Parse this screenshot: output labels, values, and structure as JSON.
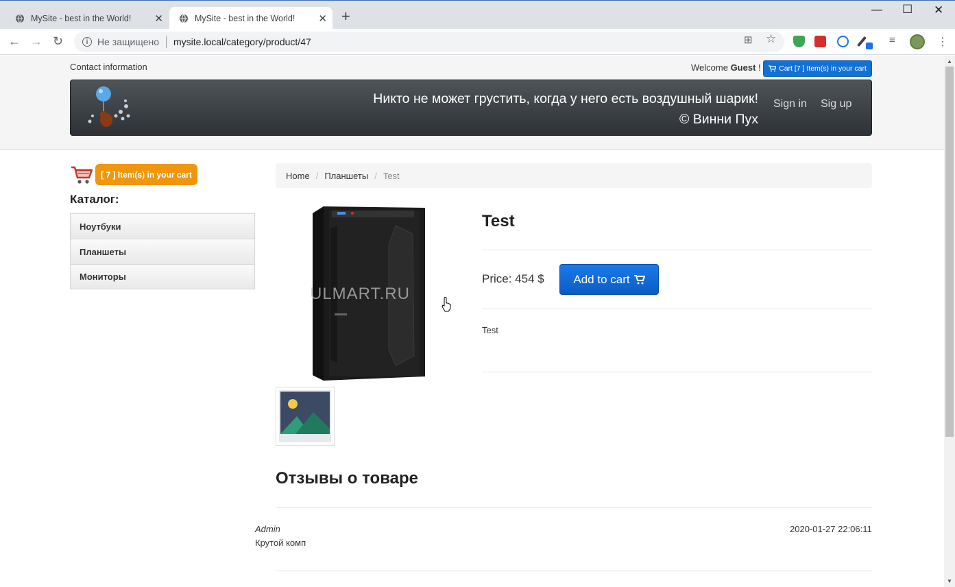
{
  "browser": {
    "tabs": [
      {
        "title": "MySite - best in the World!",
        "active": false
      },
      {
        "title": "MySite - best in the World!",
        "active": true
      }
    ],
    "security_label": "Не защищено",
    "url": "mysite.local/category/product/47"
  },
  "topbar": {
    "contact_link": "Contact information",
    "welcome_prefix": "Welcome ",
    "welcome_user": "Guest",
    "welcome_suffix": " !",
    "cart_button": "Cart [7 ] Item(s) in your cart"
  },
  "banner": {
    "quote_line1": "Никто не может грустить, когда у него есть воздушный шарик!",
    "quote_line2": "© Винни Пух",
    "signin": "Sign in",
    "signup": "Sig up"
  },
  "sidebar": {
    "cart_badge": "[ 7 ] Item(s) in your cart",
    "catalog_title": "Каталог:",
    "categories": [
      {
        "label": "Ноутбуки"
      },
      {
        "label": "Планшеты"
      },
      {
        "label": "Мониторы"
      }
    ]
  },
  "breadcrumb": {
    "home": "Home",
    "category": "Планшеты",
    "current": "Test",
    "separator": "/"
  },
  "product": {
    "title": "Test",
    "price": "Price: 454 $",
    "add_to_cart": "Add to cart",
    "description": "Test",
    "watermark": "ULMART.RU"
  },
  "reviews": {
    "title": "Отзывы о товаре",
    "items": [
      {
        "author": "Admin",
        "text": "Крутой комп",
        "date": "2020-01-27 22:06:11"
      }
    ]
  },
  "colors": {
    "cart_button": "#1271d6",
    "cart_badge": "#f0960c",
    "add_to_cart": "#0b5cc4",
    "banner": "#3a3e42"
  }
}
